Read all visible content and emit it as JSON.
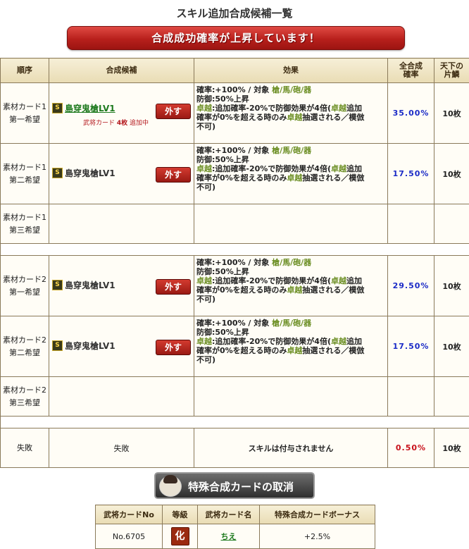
{
  "page_title": "スキル追加合成候補一覧",
  "banner": "合成成功確率が上昇しています！",
  "headers": {
    "order": "順序",
    "candidate": "合成候補",
    "effect": "効果",
    "rate_line1": "全合成",
    "rate_line2": "確率",
    "count_line1": "天下の",
    "count_line2": "片鱗"
  },
  "remove_label": "外す",
  "skill_badge": "S",
  "effect_lines": {
    "l1a": "確率:+100% / 対象 ",
    "l1b": "槍/馬/砲/器",
    "l2": "防御:50%上昇",
    "l3a": "卓越",
    "l3b": ":追加確率-20%で防御効果が4倍(",
    "l3c": "卓越",
    "l3d": "追加",
    "l4a": "確率が0%を超える時のみ",
    "l4b": "卓越",
    "l4c": "抽選される／模倣",
    "l5": "不可)"
  },
  "rows": [
    {
      "order1": "素材カード1",
      "order2": "第一希望",
      "skill": "島穿鬼槍LV1",
      "note_pre": "武将カード ",
      "note_bold": "4枚",
      "note_post": " 追加中",
      "rate": "35.00%",
      "count": "10枚"
    },
    {
      "order1": "素材カード1",
      "order2": "第二希望",
      "skill": "島穿鬼槍LV1",
      "rate": "17.50%",
      "count": "10枚"
    },
    {
      "order1": "素材カード1",
      "order2": "第三希望"
    },
    {
      "order1": "素材カード2",
      "order2": "第一希望",
      "skill": "島穿鬼槍LV1",
      "rate": "29.50%",
      "count": "10枚"
    },
    {
      "order1": "素材カード2",
      "order2": "第二希望",
      "skill": "島穿鬼槍LV1",
      "rate": "17.50%",
      "count": "10枚"
    },
    {
      "order1": "素材カード2",
      "order2": "第三希望"
    }
  ],
  "fail": {
    "order": "失敗",
    "candidate": "失敗",
    "effect": "スキルは付与されません",
    "rate": "0.50%",
    "count": "10枚"
  },
  "cancel_button": "特殊合成カードの取消",
  "special_table": {
    "headers": [
      "武将カードNo",
      "等級",
      "武将カード名",
      "特殊合成カードボーナス"
    ],
    "row": {
      "no": "No.6705",
      "rank": "化",
      "name": "ちえ",
      "bonus": "+2.5%"
    }
  },
  "colors": {
    "rate_blue": "#1a2ac7",
    "rate_red": "#c8101a",
    "banner_red": "#b8201c",
    "skill_green": "#6b8e23"
  }
}
